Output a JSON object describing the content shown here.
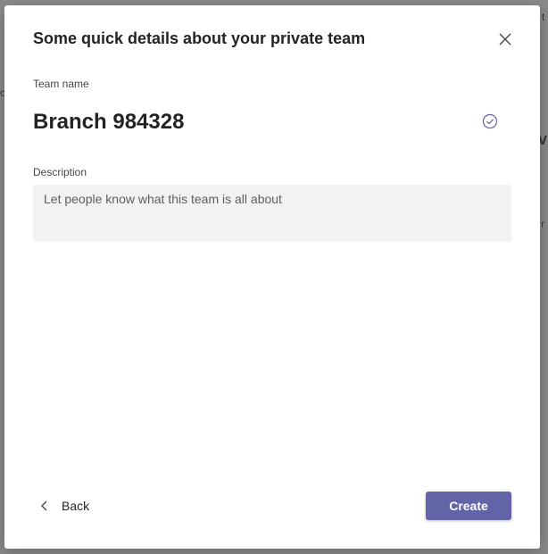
{
  "background": {
    "peek_a": "t",
    "peek_b": "vi",
    "peek_c": "r",
    "peek_d": "c"
  },
  "dialog": {
    "title": "Some quick details about your private team",
    "close_icon": "close-icon",
    "team_name": {
      "label": "Team name",
      "value": "Branch 984328",
      "status_icon": "check-circle-icon"
    },
    "description": {
      "label": "Description",
      "placeholder": "Let people know what this team is all about",
      "value": ""
    },
    "footer": {
      "back_label": "Back",
      "back_icon": "chevron-left-icon",
      "create_label": "Create"
    }
  },
  "colors": {
    "accent": "#6264a7",
    "overlay": "#8a8a8a",
    "input_background": "#f3f2f1",
    "text": "#252423"
  }
}
